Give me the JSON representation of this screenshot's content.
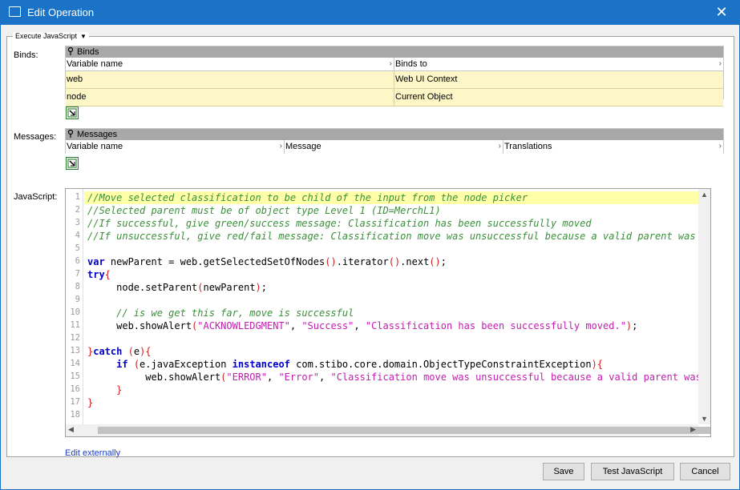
{
  "window": {
    "title": "Edit Operation",
    "close_glyph": "✕"
  },
  "group": {
    "selector_label": "Execute JavaScript",
    "caret": "▼"
  },
  "binds": {
    "label": "Binds:",
    "title": "Binds",
    "columns": [
      "Variable name",
      "Binds to"
    ],
    "rows": [
      {
        "variable": "web",
        "binds_to": "Web UI Context"
      },
      {
        "variable": "node",
        "binds_to": "Current Object"
      }
    ]
  },
  "messages": {
    "label": "Messages:",
    "title": "Messages",
    "columns": [
      "Variable name",
      "Message",
      "Translations"
    ]
  },
  "javascript": {
    "label": "JavaScript:",
    "line_numbers": [
      "1",
      "2",
      "3",
      "4",
      "5",
      "6",
      "7",
      "8",
      "9",
      "10",
      "11",
      "12",
      "13",
      "14",
      "15",
      "16",
      "17",
      "18"
    ],
    "edit_externally": "Edit externally"
  },
  "buttons": {
    "save": "Save",
    "test": "Test JavaScript",
    "cancel": "Cancel"
  },
  "icons": {
    "pin": "pin-icon",
    "edit": "edit-icon",
    "sort_arrow": "›"
  },
  "colors": {
    "titlebar": "#1a73c7",
    "row_bg": "#fdf7c8",
    "comment": "#3a8f3a",
    "keyword": "#0000c8",
    "string": "#c21eb0"
  }
}
